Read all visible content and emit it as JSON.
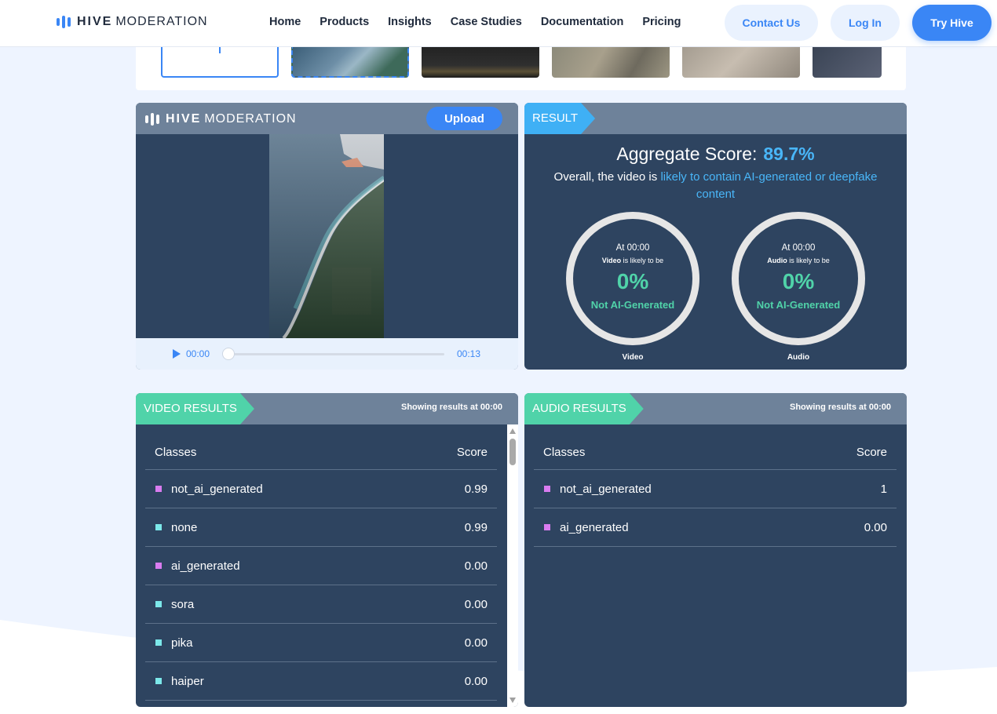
{
  "header": {
    "brand_bold": "HIVE",
    "brand_light": "MODERATION",
    "nav": [
      "Home",
      "Products",
      "Insights",
      "Case Studies",
      "Documentation",
      "Pricing"
    ],
    "contact_label": "Contact Us",
    "login_label": "Log In",
    "try_label": "Try Hive"
  },
  "colors": {
    "accent": "#3a86f5",
    "panel": "#2e4460",
    "result_tag": "#3fb0f5",
    "results_tag": "#50d3a9",
    "not_ai": "#50d3a9"
  },
  "video_player": {
    "brand_bold": "HIVE",
    "brand_light": "MODERATION",
    "upload_label": "Upload",
    "current_time": "00:00",
    "duration": "00:13",
    "progress": 0
  },
  "result": {
    "tag": "RESULT",
    "aggregate_label": "Aggregate Score:",
    "aggregate_score": "89.7%",
    "overall_prefix": "Overall, the video is",
    "overall_highlight": "likely to contain AI-generated or deepfake content",
    "video_gauge": {
      "at": "At 00:00",
      "subject": "Video",
      "likely": "is likely to be",
      "percent": "0%",
      "verdict": "Not AI-Generated",
      "label": "Video"
    },
    "audio_gauge": {
      "at": "At 00:00",
      "subject": "Audio",
      "likely": "is likely to be",
      "percent": "0%",
      "verdict": "Not AI-Generated",
      "label": "Audio"
    }
  },
  "video_results": {
    "tag": "VIDEO RESULTS",
    "showing_prefix": "Showing results at",
    "showing_time": "00:00",
    "col_classes": "Classes",
    "col_score": "Score",
    "rows": [
      {
        "name": "not_ai_generated",
        "score": "0.99",
        "color": "#d97cf0"
      },
      {
        "name": "none",
        "score": "0.99",
        "color": "#7ce8ea"
      },
      {
        "name": "ai_generated",
        "score": "0.00",
        "color": "#d97cf0"
      },
      {
        "name": "sora",
        "score": "0.00",
        "color": "#7ce8ea"
      },
      {
        "name": "pika",
        "score": "0.00",
        "color": "#7ce8ea"
      },
      {
        "name": "haiper",
        "score": "0.00",
        "color": "#7ce8ea"
      }
    ]
  },
  "audio_results": {
    "tag": "AUDIO RESULTS",
    "showing_prefix": "Showing results at",
    "showing_time": "00:00",
    "col_classes": "Classes",
    "col_score": "Score",
    "rows": [
      {
        "name": "not_ai_generated",
        "score": "1",
        "color": "#d97cf0"
      },
      {
        "name": "ai_generated",
        "score": "0.00",
        "color": "#d97cf0"
      }
    ]
  }
}
